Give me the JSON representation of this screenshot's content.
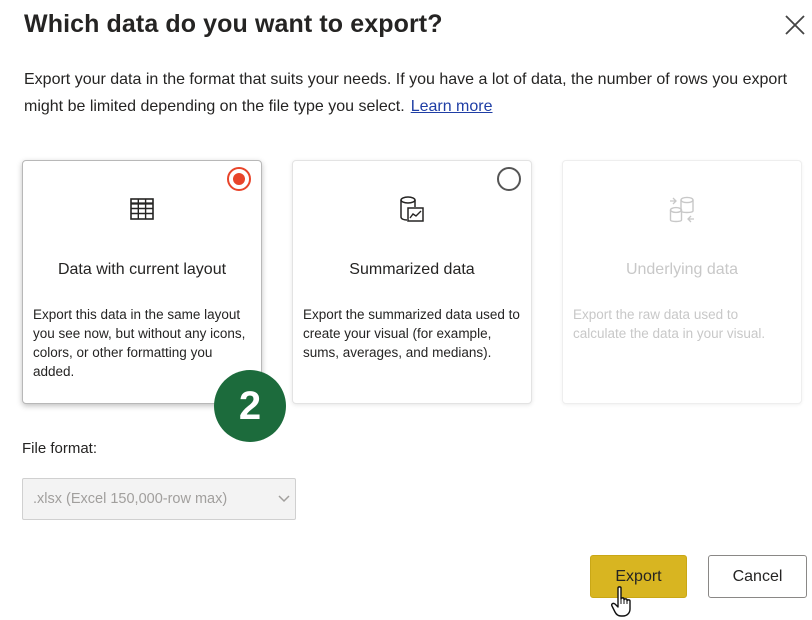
{
  "dialog": {
    "title": "Which data do you want to export?",
    "description": "Export your data in the format that suits your needs. If you have a lot of data, the number of rows you export might be limited depending on the file type you select.",
    "learn_more": "Learn more",
    "close_icon": "close-icon"
  },
  "options": [
    {
      "title": "Data with current layout",
      "description": "Export this data in the same layout you see now, but without any icons, colors, or other formatting you added.",
      "selected": true,
      "enabled": true,
      "icon": "table-icon"
    },
    {
      "title": "Summarized data",
      "description": "Export the summarized data used to create your visual (for example, sums, averages, and medians).",
      "selected": false,
      "enabled": true,
      "icon": "summarized-data-icon"
    },
    {
      "title": "Underlying data",
      "description": "Export the raw data used to calculate the data in your visual.",
      "selected": false,
      "enabled": false,
      "icon": "underlying-data-icon"
    }
  ],
  "callout_badge": "2",
  "file_format": {
    "label": "File format:",
    "value": ".xlsx (Excel 150,000-row max)"
  },
  "buttons": {
    "export": "Export",
    "cancel": "Cancel"
  },
  "colors": {
    "radio_selected": "#e8442a",
    "export_button": "#d8b521",
    "badge": "#1c6b3c",
    "link": "#1f3ea5"
  }
}
